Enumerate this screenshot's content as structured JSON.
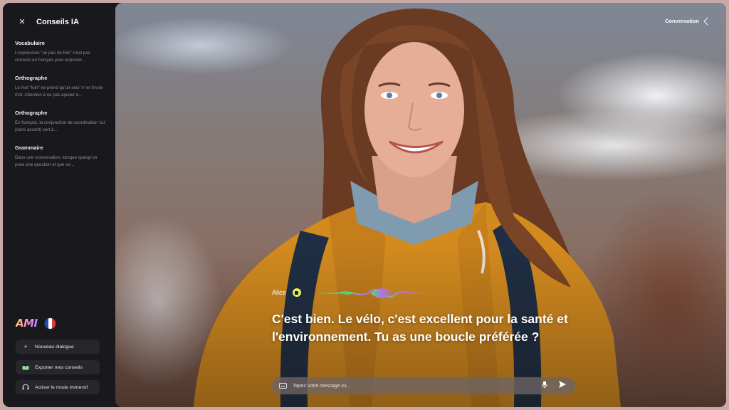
{
  "sidebar": {
    "title": "Conseils IA",
    "close_icon": "close-icon",
    "tips": [
      {
        "title": "Vocabulaire",
        "text": "L'expression \"un peu de fois\" n'est pas correcte en français pour exprimer..."
      },
      {
        "title": "Orthographe",
        "text": "Le mot \"loin\" ne prend qu'un seul 'n' en fin de mot. Attention à ne pas ajouter d..."
      },
      {
        "title": "Orthographe",
        "text": "En français, la conjonction de coordination 'ou' (sans accent) sert à..."
      },
      {
        "title": "Grammaire",
        "text": "Dans une conversation, lorsque quelqu'un pose une question et que vo..."
      }
    ],
    "brand": {
      "logo": "AMI",
      "flag": "france-flag"
    },
    "buttons": [
      {
        "label": "Nouveau dialogue",
        "icon": "plus-icon"
      },
      {
        "label": "Exporter mes conseils",
        "icon": "export-icon"
      },
      {
        "label": "Activer le mode immersif",
        "icon": "headphones-icon"
      }
    ]
  },
  "main": {
    "conversation_toggle": "Conversation",
    "speaker": {
      "name": "Alice",
      "stop_icon": "stop-icon"
    },
    "caption": "C'est bien. Le vélo, c'est excellent pour la santé et l'environnement. Tu as une boucle préférée ?",
    "composer": {
      "placeholder": "Tapez votre message ici...",
      "value": ""
    }
  },
  "colors": {
    "sidebar_bg": "#18181d",
    "button_bg": "#26262d",
    "stop_accent": "#e4f05a",
    "wave_green": "#4de08a",
    "wave_purple": "#b36bff",
    "jacket": "#d48b1e"
  }
}
